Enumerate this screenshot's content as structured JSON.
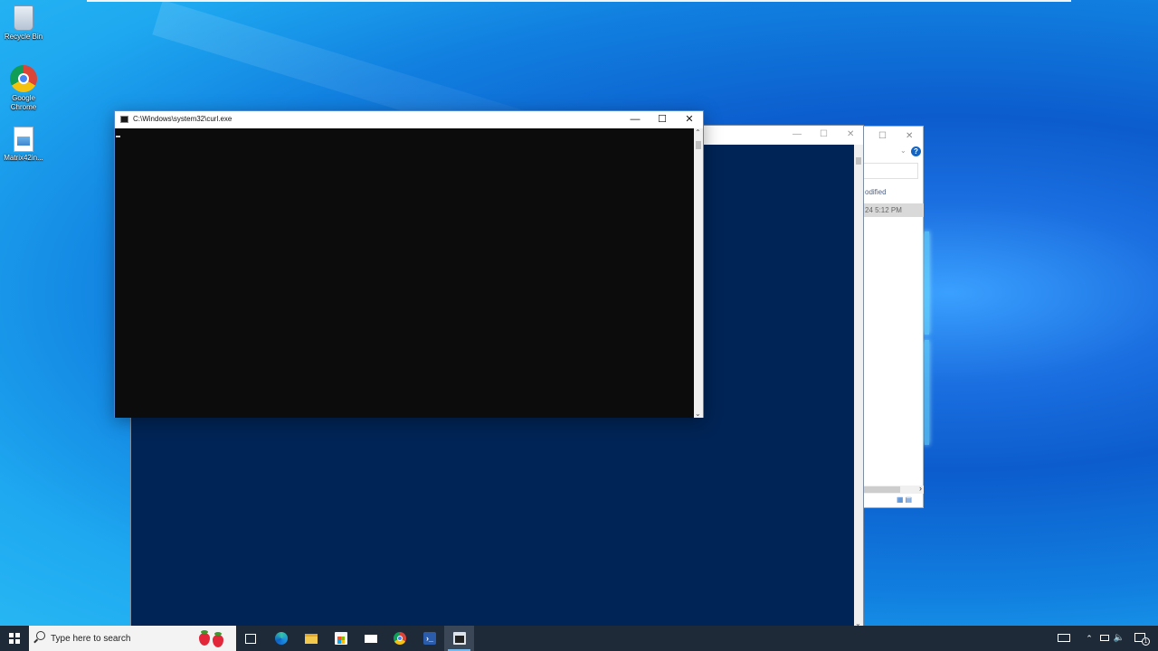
{
  "desktop": {
    "icons": [
      {
        "label": "Recycle Bin"
      },
      {
        "label": "Google Chrome"
      },
      {
        "label": "Matrix42in..."
      }
    ]
  },
  "explorer_window": {
    "column_header": "odified",
    "row_date": "24 5:12 PM"
  },
  "cmd_window": {
    "title": "C:\\Windows\\system32\\curl.exe",
    "minimize": "—",
    "maximize": "☐",
    "close": "✕"
  },
  "taskbar": {
    "search_placeholder": "Type here to search",
    "notification_count": "1"
  },
  "colors": {
    "console_bg": "#0c0c0c",
    "powershell_bg": "#012456",
    "taskbar_bg": "#1f2a38",
    "accent": "#76b9ed"
  }
}
